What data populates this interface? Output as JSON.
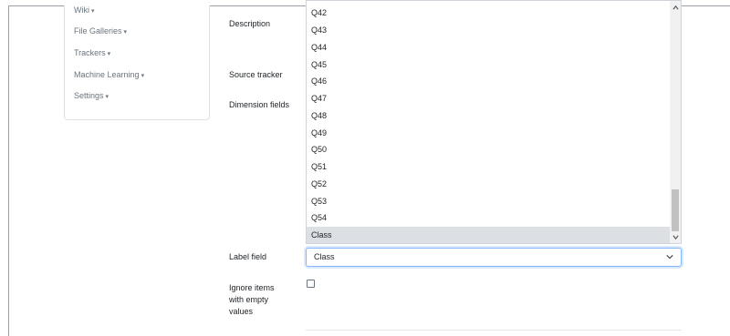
{
  "sidebar": {
    "items": [
      {
        "label": "Wiki",
        "caret": "▾"
      },
      {
        "label": "File Galleries",
        "caret": "▾"
      },
      {
        "label": "Trackers",
        "caret": "▾"
      },
      {
        "label": "Machine Learning",
        "caret": "▾"
      },
      {
        "label": "Settings",
        "caret": "▾"
      }
    ]
  },
  "form": {
    "labels": {
      "description": "Description",
      "source_tracker": "Source tracker",
      "dimension_fields": "Dimension fields",
      "label_field": "Label field",
      "ignore_items": [
        "Ignore items",
        "with empty",
        "values"
      ]
    },
    "dimension_options": [
      "Q42",
      "Q43",
      "Q44",
      "Q45",
      "Q46",
      "Q47",
      "Q48",
      "Q49",
      "Q50",
      "Q51",
      "Q52",
      "Q53",
      "Q54",
      "Class"
    ],
    "dimension_selected": "Class",
    "label_field_value": "Class",
    "ignore_items_checked": false
  },
  "colors": {
    "focus_border": "#86b7fe",
    "selected_option_bg": "#dcdfe3"
  }
}
